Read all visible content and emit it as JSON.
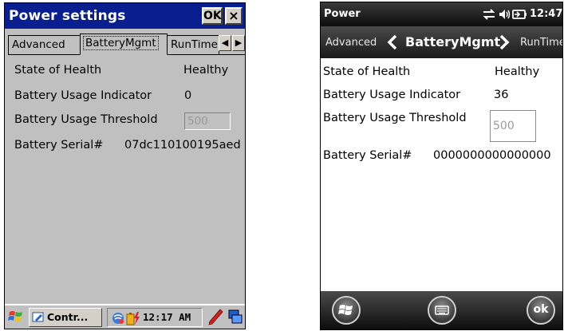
{
  "left": {
    "title": "Power settings",
    "ok_label": "OK",
    "close_label": "×",
    "tabs": [
      "Advanced",
      "BatteryMgmt",
      "RunTime"
    ],
    "active_tab": "BatteryMgmt",
    "fields": {
      "health_label": "State of Health",
      "health_value": "Healthy",
      "usage_label": "Battery Usage Indicator",
      "usage_value": "0",
      "threshold_label": "Battery Usage Threshold",
      "threshold_value": "500",
      "serial_label": "Battery Serial#",
      "serial_value": "07dc110100195aed"
    },
    "taskbar": {
      "task_label": "Contr...",
      "clock": "12:17 AM"
    }
  },
  "right": {
    "status_title": "Power",
    "time": "12:47",
    "tabs": {
      "prev": "Advanced",
      "current": "BatteryMgmt",
      "next": "RunTime"
    },
    "fields": {
      "health_label": "State of Health",
      "health_value": "Healthy",
      "usage_label": "Battery Usage Indicator",
      "usage_value": "36",
      "threshold_label": "Battery Usage Threshold",
      "threshold_value": "500",
      "serial_label": "Battery Serial#",
      "serial_value": "0000000000000000"
    },
    "softkeys": {
      "ok_label": "ok"
    }
  }
}
